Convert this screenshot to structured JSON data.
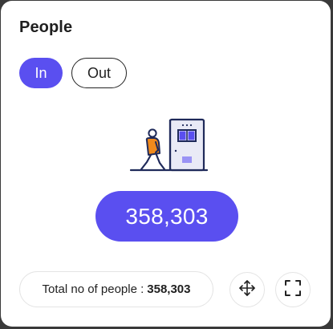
{
  "card": {
    "title": "People"
  },
  "toggle": {
    "in_label": "In",
    "out_label": "Out",
    "selected": "In"
  },
  "main": {
    "count": "358,303"
  },
  "footer": {
    "total_label": "Total no of people :",
    "total_value": "358,303",
    "move_icon": "move-arrows-icon",
    "expand_icon": "fullscreen-icon"
  },
  "colors": {
    "accent": "#5a4ff0",
    "person_orange": "#f08a1c",
    "outline": "#1f2a5a"
  }
}
